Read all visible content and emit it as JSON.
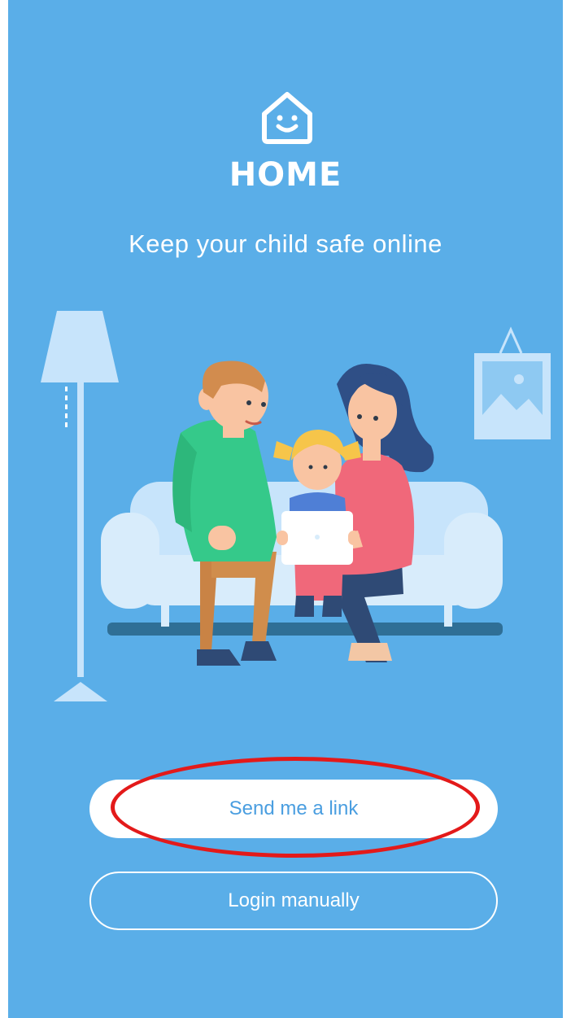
{
  "app": {
    "brand_name": "HOME",
    "tagline": "Keep your child safe online"
  },
  "icons": {
    "logo": "house-smile-icon"
  },
  "actions": {
    "send_link_label": "Send me a link",
    "login_manual_label": "Login manually"
  },
  "annotation": {
    "highlight_color": "#e31a1a"
  },
  "colors": {
    "background": "#5aaee8",
    "primary_button_bg": "#ffffff",
    "primary_button_text": "#4a9ee0"
  }
}
